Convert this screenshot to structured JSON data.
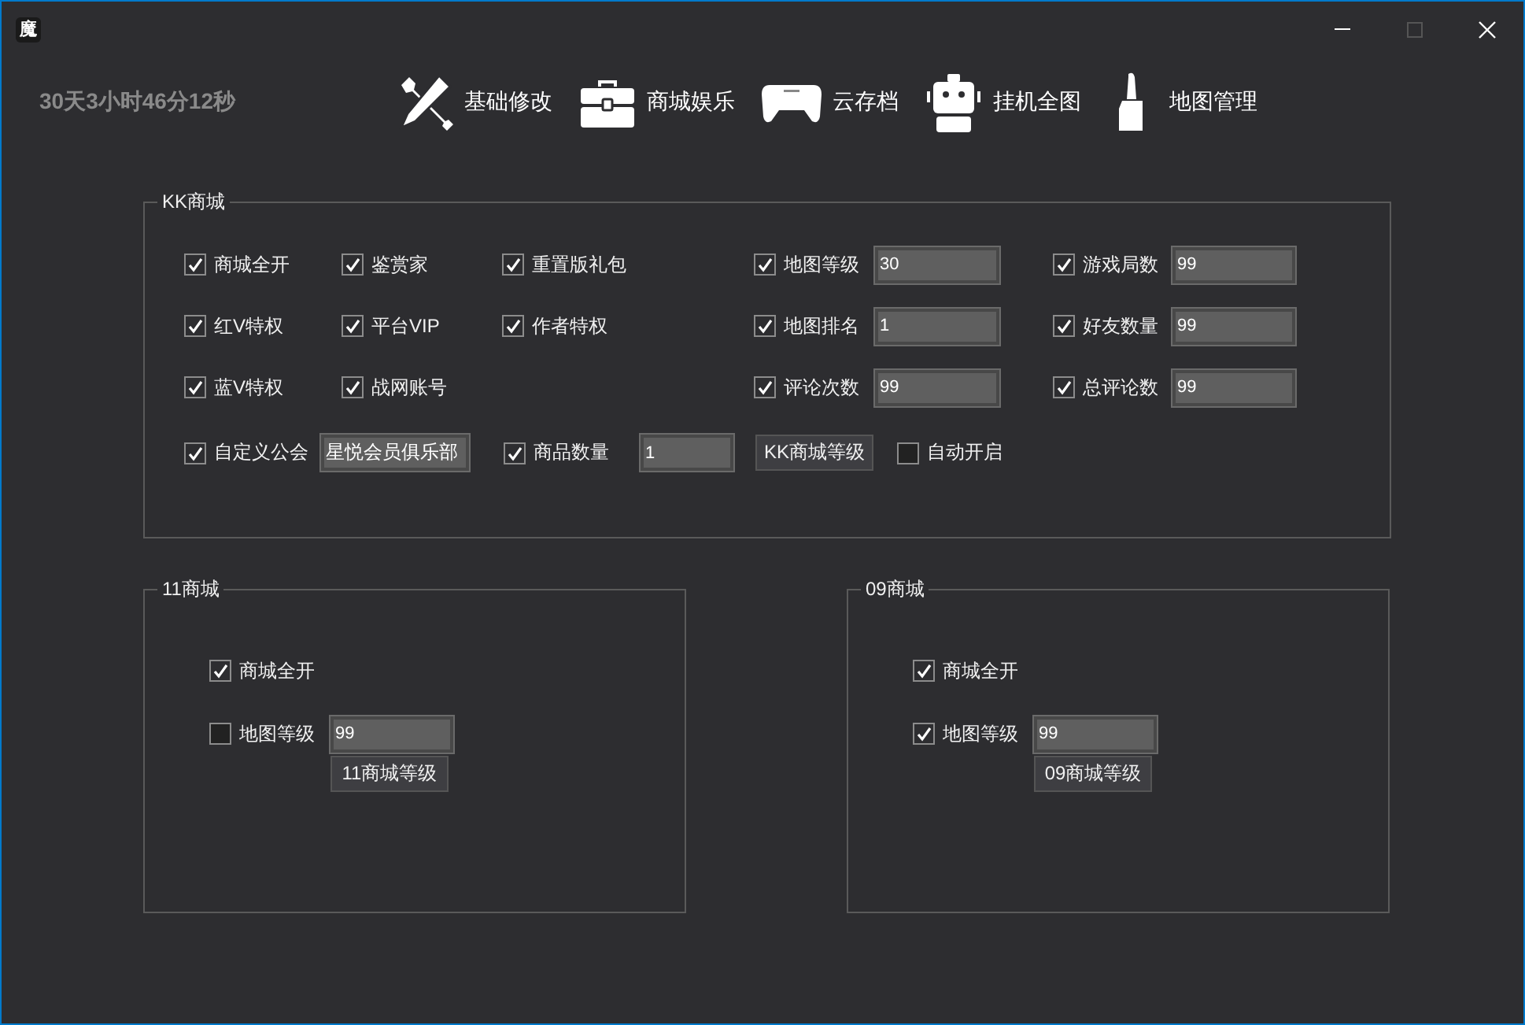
{
  "window": {
    "icon": "魔",
    "maximize_disabled": true
  },
  "timer": "30天3小时46分12秒",
  "nav": [
    {
      "label": "基础修改"
    },
    {
      "label": "商城娱乐"
    },
    {
      "label": "云存档"
    },
    {
      "label": "挂机全图"
    },
    {
      "label": "地图管理"
    }
  ],
  "kk": {
    "title": "KK商城",
    "columns": [
      [
        {
          "kind": "check",
          "label": "商城全开",
          "checked": true
        },
        {
          "kind": "check",
          "label": "红V特权",
          "checked": true
        },
        {
          "kind": "check",
          "label": "蓝V特权",
          "checked": true
        }
      ],
      [
        {
          "kind": "check",
          "label": "鉴赏家",
          "checked": true
        },
        {
          "kind": "check",
          "label": "平台VIP",
          "checked": true
        },
        {
          "kind": "check",
          "label": "战网账号",
          "checked": true
        }
      ],
      [
        {
          "kind": "check",
          "label": "重置版礼包",
          "checked": true
        },
        {
          "kind": "check",
          "label": "作者特权",
          "checked": true
        }
      ],
      [
        {
          "kind": "check-field",
          "label": "地图等级",
          "checked": true,
          "value": "30"
        },
        {
          "kind": "check-field",
          "label": "地图排名",
          "checked": true,
          "value": "1"
        },
        {
          "kind": "check-field",
          "label": "评论次数",
          "checked": true,
          "value": "99"
        }
      ],
      [
        {
          "kind": "check-field",
          "label": "游戏局数",
          "checked": true,
          "value": "99"
        },
        {
          "kind": "check-field",
          "label": "好友数量",
          "checked": true,
          "value": "99"
        },
        {
          "kind": "check-field",
          "label": "总评论数",
          "checked": true,
          "value": "99"
        }
      ]
    ],
    "bottom": [
      {
        "kind": "check-field",
        "label": "自定义公会",
        "checked": true,
        "value": "星悦会员俱乐部"
      },
      {
        "kind": "check-field",
        "label": "商品数量",
        "checked": true,
        "value": "1"
      },
      {
        "kind": "button",
        "label": "KK商城等级"
      },
      {
        "kind": "check",
        "label": "自动开启",
        "checked": false
      }
    ]
  },
  "groups": [
    {
      "title": "11商城",
      "options": [
        {
          "kind": "check",
          "label": "商城全开",
          "checked": true
        },
        {
          "kind": "check-field",
          "label": "地图等级",
          "checked": false,
          "value": "99"
        }
      ],
      "button": "11商城等级"
    },
    {
      "title": "09商城",
      "options": [
        {
          "kind": "check",
          "label": "商城全开",
          "checked": true
        },
        {
          "kind": "check-field",
          "label": "地图等级",
          "checked": true,
          "value": "99"
        }
      ],
      "button": "09商城等级"
    }
  ]
}
